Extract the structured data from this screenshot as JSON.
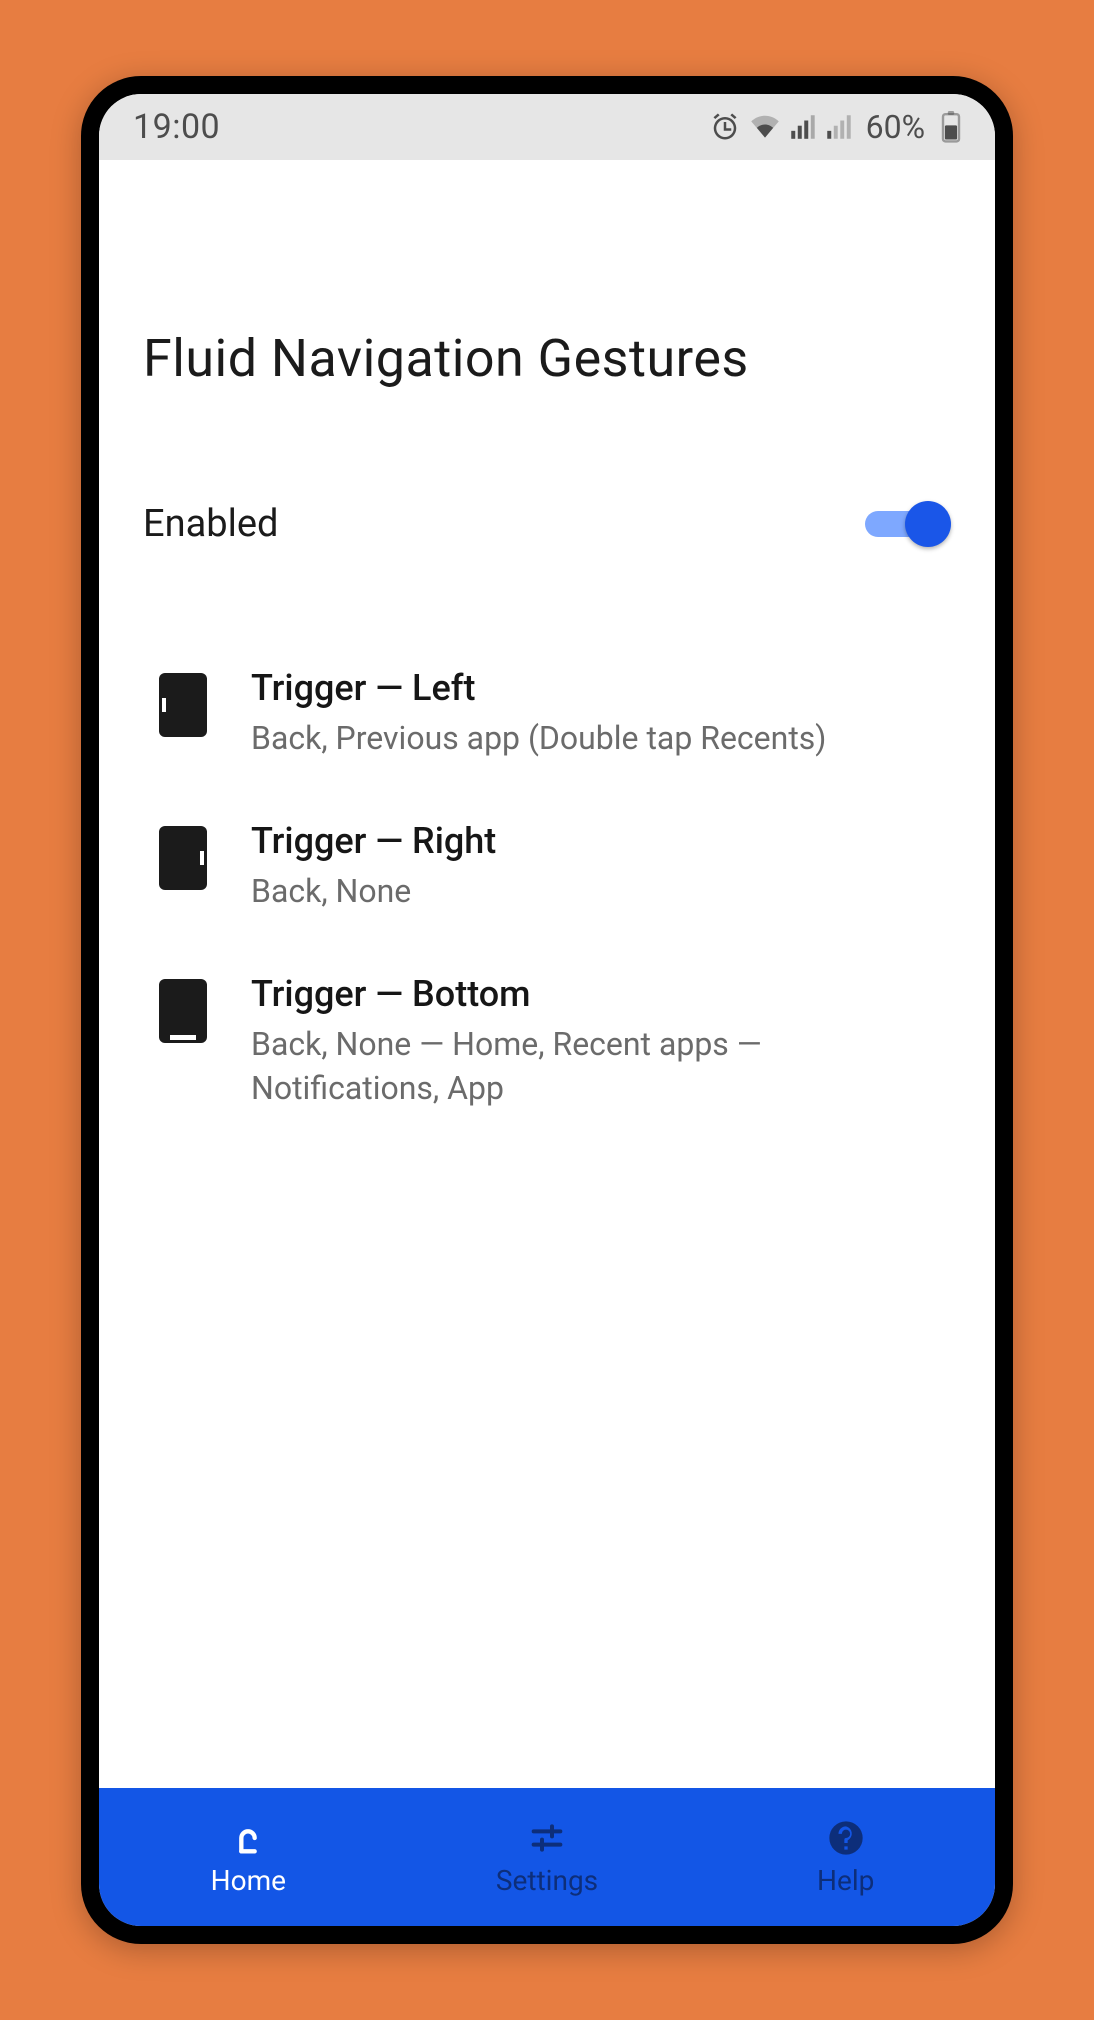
{
  "statusbar": {
    "time": "19:00",
    "battery_text": "60%"
  },
  "page": {
    "title": "Fluid Navigation Gestures"
  },
  "toggle": {
    "label": "Enabled",
    "state": "on"
  },
  "triggers": [
    {
      "edge": "left",
      "title": "Trigger — Left",
      "subtitle": "Back, Previous app (Double tap Recents)"
    },
    {
      "edge": "right",
      "title": "Trigger — Right",
      "subtitle": "Back, None"
    },
    {
      "edge": "bottom",
      "title": "Trigger — Bottom",
      "subtitle": "Back, None — Home, Recent apps — Notifications, App"
    }
  ],
  "bottomnav": {
    "items": [
      {
        "label": "Home",
        "active": true
      },
      {
        "label": "Settings",
        "active": false
      },
      {
        "label": "Help",
        "active": false
      }
    ]
  }
}
